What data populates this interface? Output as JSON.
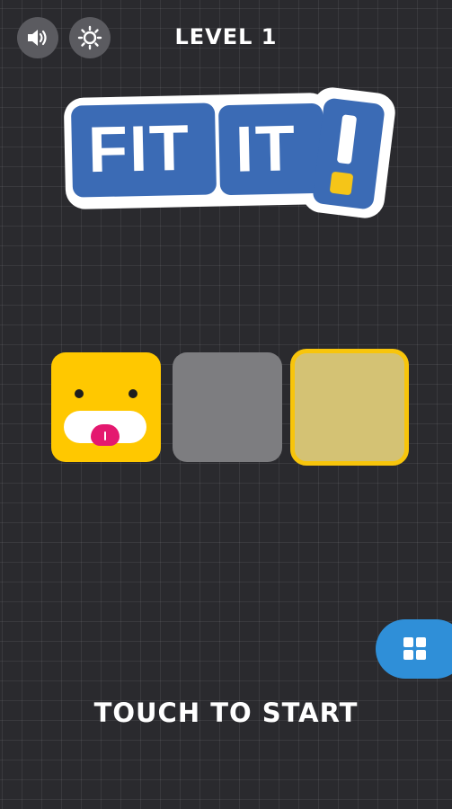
{
  "header": {
    "level_label": "LEVEL 1",
    "sound_icon": "speaker-icon",
    "theme_icon": "sun-icon"
  },
  "logo": {
    "word1": "FIT",
    "word2": "IT",
    "mark": "!"
  },
  "board": {
    "character": "yellow-face-block",
    "slots": [
      "character",
      "empty",
      "target"
    ]
  },
  "menu": {
    "icon": "grid-icon"
  },
  "prompt": {
    "start_label": "TOUCH TO START"
  },
  "colors": {
    "background": "#2a2a2e",
    "logo_blue": "#3b6bb5",
    "block_yellow": "#ffc800",
    "tongue_pink": "#e4186f",
    "empty_slot_gray": "#7d7d80",
    "target_fill": "#d4c274",
    "target_border": "#f8c50b",
    "menu_blue": "#2f8fd8",
    "icon_button_gray": "#5b5b60"
  }
}
